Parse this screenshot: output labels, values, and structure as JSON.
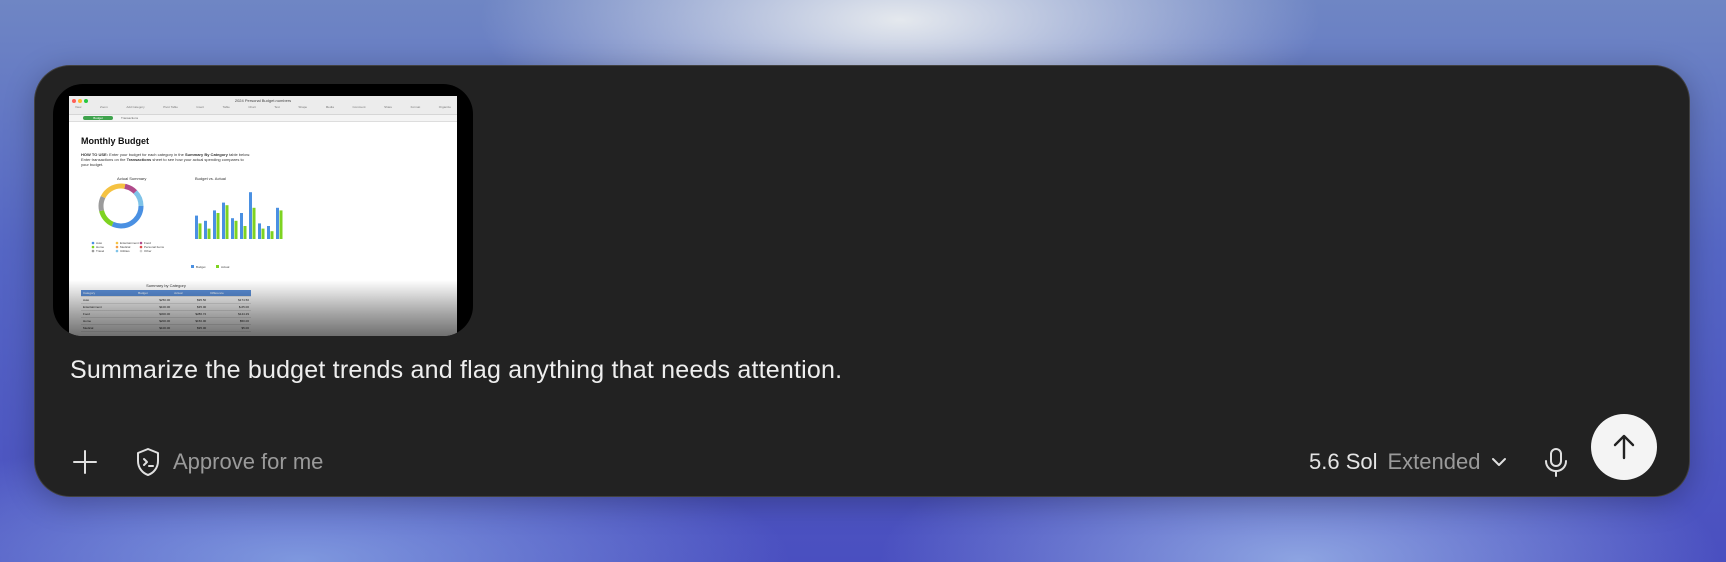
{
  "attachment": {
    "spreadsheet": {
      "doc_title": "2024 Personal Budget.numbers",
      "toolbar_items": [
        "View",
        "Zoom",
        "Add Category",
        "Pivot Table",
        "Insert",
        "Table",
        "Chart",
        "Text",
        "Shape",
        "Media",
        "Comment",
        "Share",
        "Format",
        "Organize"
      ],
      "tabs": [
        "Budget",
        "Transactions"
      ],
      "title": "Monthly Budget",
      "how_to_prefix": "HOW TO USE:",
      "how_to_1": " Enter your budget for each category in the ",
      "how_to_bold_1": "Summary By Category",
      "how_to_2": " table below. Enter transactions on the ",
      "how_to_bold_2": "Transactions",
      "how_to_3": " sheet to see how your actual spending compares to your budget.",
      "pie_title": "Actual Summary",
      "bar_title": "Budget vs. Actual",
      "bar_legend": [
        "Budget",
        "Actual"
      ],
      "pie_legend": [
        "Auto",
        "Entertainment",
        "Food",
        "Home",
        "Medical",
        "Personal Items",
        "Travel",
        "Utilities",
        "Other"
      ],
      "table_title": "Summary by Category",
      "table_headers": [
        "Category",
        "Budget",
        "Actual",
        "Difference"
      ],
      "table_rows": [
        [
          "Auto",
          "$250.00",
          "$95.50",
          "$174.50"
        ],
        [
          "Entertainment",
          "$100.00",
          "$35.00",
          "$-65.00"
        ],
        [
          "Food",
          "$300.00",
          "$286.72",
          "$144.29"
        ],
        [
          "Home",
          "$200.00",
          "$150.00",
          "$50.00"
        ],
        [
          "Medical",
          "$100.00",
          "$95.00",
          "$5.00"
        ]
      ],
      "colors": {
        "budget": "#4a90e2",
        "actual": "#7ed321",
        "tab_green": "#3fa34d",
        "header_blue": "#5b8fd8"
      }
    }
  },
  "prompt_text": "Summarize the budget trends and flag anything that needs attention.",
  "toolbar": {
    "add_icon": "plus-icon",
    "approve_icon": "shield-terminal-icon",
    "approve_label": "Approve for me",
    "model_name": "5.6 Sol",
    "model_mode": "Extended",
    "dropdown_icon": "chevron-down-icon",
    "mic_icon": "microphone-icon",
    "send_icon": "arrow-up-icon"
  }
}
